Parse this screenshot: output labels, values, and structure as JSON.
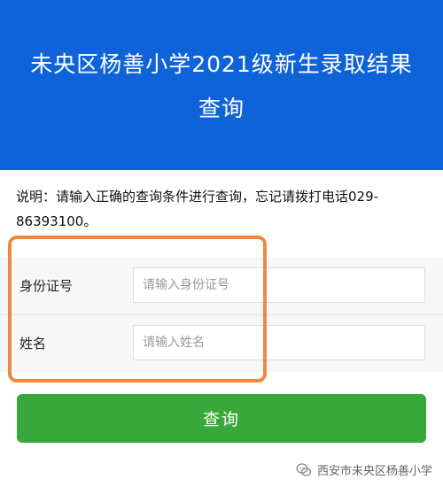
{
  "header": {
    "title": "未央区杨善小学2021级新生录取结果查询"
  },
  "notice": {
    "text": "说明：请输入正确的查询条件进行查询，忘记请拨打电话029-86393100。"
  },
  "form": {
    "id_card": {
      "label": "身份证号",
      "placeholder": "请输入身份证号",
      "value": ""
    },
    "name": {
      "label": "姓名",
      "placeholder": "请输入姓名",
      "value": ""
    }
  },
  "submit": {
    "label": "查询"
  },
  "watermark": {
    "text": "西安市未央区杨善小学",
    "icon": "wechat-icon"
  },
  "colors": {
    "header_bg": "#0f63d9",
    "button_bg": "#39a83b",
    "highlight_border": "#f08a3a"
  }
}
